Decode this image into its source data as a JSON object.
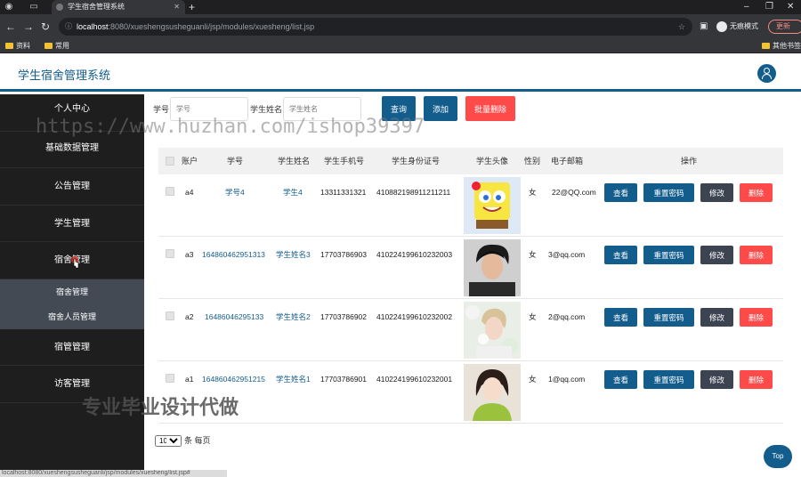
{
  "browser": {
    "tab_title": "学生宿舍管理系统",
    "url_host": "localhost",
    "url_rest": ":8080/xueshengsusheguanli/jsp/modules/xuesheng/list.jsp",
    "incognito_label": "无痕模式",
    "update_label": "更新",
    "bookmarks": [
      "资料",
      "常用"
    ],
    "bookmarks_right": "其他书签",
    "status_url": "localhost:8080/xueshengsusheguanli/jsp/modules/xuesheng/list.jsp#"
  },
  "app": {
    "title": "学生宿舍管理系统"
  },
  "sidebar": {
    "items": [
      {
        "label": "个人中心"
      },
      {
        "label": "基础数据管理"
      },
      {
        "label": "公告管理"
      },
      {
        "label": "学生管理"
      },
      {
        "label": "宿舍管理"
      }
    ],
    "submenu": [
      "宿舍管理",
      "宿舍人员管理"
    ],
    "items_after": [
      {
        "label": "宿管管理"
      },
      {
        "label": "访客管理"
      }
    ]
  },
  "search": {
    "student_id_label": "学号",
    "student_id_placeholder": "学号",
    "name_label": "学生姓名",
    "name_placeholder": "学生姓名",
    "query_button": "查询",
    "add_button": "添加",
    "batch_delete_button": "批量删除"
  },
  "table": {
    "headers": [
      "账户",
      "学号",
      "学生姓名",
      "学生手机号",
      "学生身份证号",
      "学生头像",
      "性别",
      "电子邮箱",
      "操作"
    ],
    "rows": [
      {
        "account": "a4",
        "student_id": "学号4",
        "name": "学生4",
        "phone": "13311331321",
        "id_card": "410882198911211211",
        "gender": "女",
        "email": "22@QQ.com",
        "avatar": "sponge-cartoon"
      },
      {
        "account": "a3",
        "student_id": "164860462951313",
        "name": "学生姓名3",
        "phone": "17703786903",
        "id_card": "410224199610232003",
        "gender": "女",
        "email": "3@qq.com",
        "avatar": "dark-portrait"
      },
      {
        "account": "a2",
        "student_id": "16486046295133",
        "name": "学生姓名2",
        "phone": "17703786902",
        "id_card": "410224199610232002",
        "gender": "女",
        "email": "2@qq.com",
        "avatar": "flower-portrait"
      },
      {
        "account": "a1",
        "student_id": "164860462951215",
        "name": "学生姓名1",
        "phone": "17703786901",
        "id_card": "410224199610232001",
        "gender": "女",
        "email": "1@qq.com",
        "avatar": "green-portrait"
      }
    ],
    "actions": {
      "view": "查看",
      "reset_password": "重置密码",
      "edit": "修改",
      "delete": "删除"
    }
  },
  "pagination": {
    "page_size": "10",
    "per_page_label": "条 每页"
  },
  "top_button": "Top",
  "watermark": {
    "url": "https://www.huzhan.com/ishop39397",
    "slogan": "专业毕业设计代做"
  },
  "colors": {
    "primary": "#135d8d",
    "danger": "#ff4a4a",
    "dark": "#3d4451",
    "sidebar": "#1e1e1e",
    "submenu": "#434a54"
  }
}
